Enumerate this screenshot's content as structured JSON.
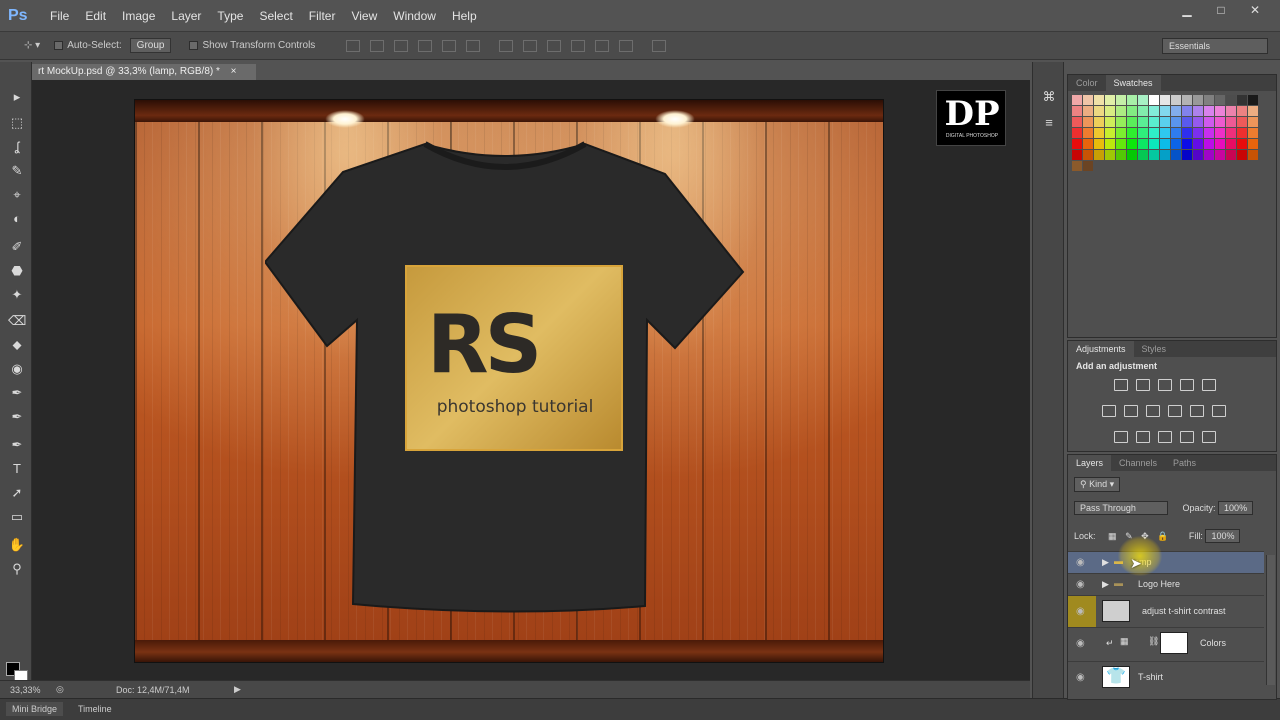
{
  "app": {
    "logo": "Ps"
  },
  "menu": [
    "File",
    "Edit",
    "Image",
    "Layer",
    "Type",
    "Select",
    "Filter",
    "View",
    "Window",
    "Help"
  ],
  "window_controls": {
    "minimize": "▁",
    "maximize": "□",
    "close": "✕"
  },
  "options": {
    "auto_select_label": "Auto-Select:",
    "auto_select_value": "Group",
    "transform_label": "Show Transform Controls",
    "workspace": "Essentials"
  },
  "document": {
    "tab_title": "rt MockUp.psd @ 33,3% (lamp, RGB/8) *",
    "tab_close": "×",
    "zoom": "33,33%",
    "doc_size": "Doc: 12,4M/71,4M"
  },
  "canvas": {
    "logo_mark": "RS",
    "logo_text": "photoshop tutorial"
  },
  "badge": {
    "title": "DP",
    "subtitle": "DIGITAL PHOTOSHOP"
  },
  "tools": [
    "▸",
    "⬚",
    "ʆ",
    "✎",
    "⌖",
    "◐",
    "✐",
    "⬣",
    "✦",
    "⌫",
    "⬥",
    "◉",
    "✒",
    "T",
    "➚",
    "▭",
    "✋",
    "⚲"
  ],
  "bottom_tabs": [
    "Mini Bridge",
    "Timeline"
  ],
  "swatches_panel": {
    "tabs": [
      "Color",
      "Swatches"
    ],
    "active": "Swatches"
  },
  "adjustments_panel": {
    "tabs": [
      "Adjustments",
      "Styles"
    ],
    "title": "Add an adjustment"
  },
  "layers_panel": {
    "tabs": [
      "Layers",
      "Channels",
      "Paths"
    ],
    "kind_label": "Kind",
    "blend_mode": "Pass Through",
    "opacity_label": "Opacity:",
    "opacity_value": "100%",
    "lock_label": "Lock:",
    "fill_label": "Fill:",
    "fill_value": "100%",
    "layers": [
      {
        "name": "lamp",
        "type": "group",
        "selected": true
      },
      {
        "name": "Logo Here",
        "type": "group",
        "selected": false
      },
      {
        "name": "adjust t-shirt contrast",
        "type": "pixel",
        "selected": false
      },
      {
        "name": "Colors",
        "type": "solid",
        "selected": false
      },
      {
        "name": "T-shirt",
        "type": "pixel",
        "selected": false
      }
    ]
  },
  "colors": {
    "selection": "#5b6a86",
    "highlight": "#ffe000",
    "logo_gold": "#d8a43a"
  }
}
